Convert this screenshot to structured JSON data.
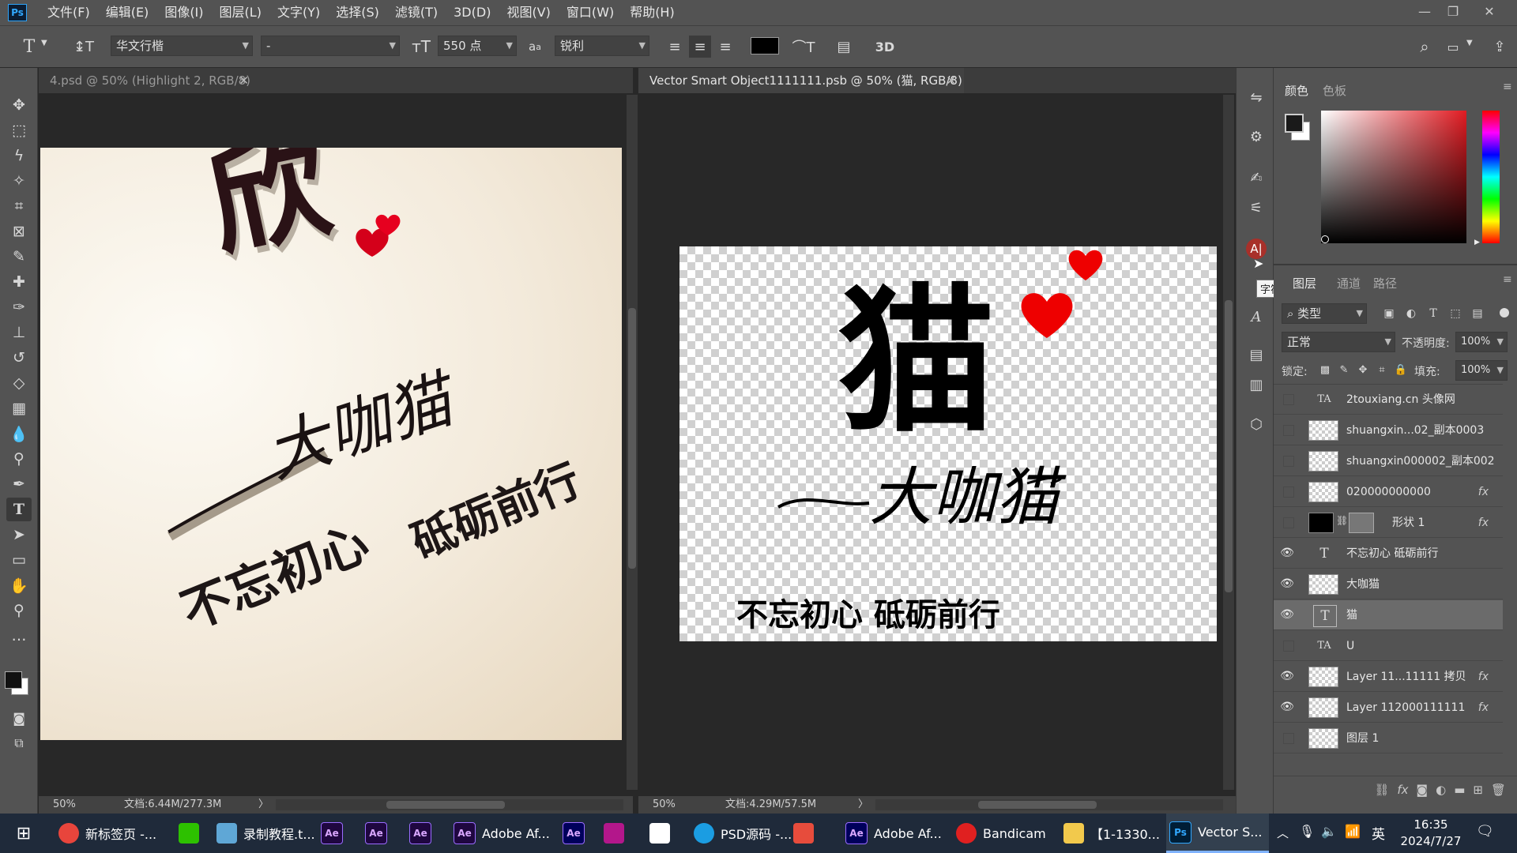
{
  "menubar": {
    "logo": "Ps",
    "items": [
      "文件(F)",
      "编辑(E)",
      "图像(I)",
      "图层(L)",
      "文字(Y)",
      "选择(S)",
      "滤镜(T)",
      "3D(D)",
      "视图(V)",
      "窗口(W)",
      "帮助(H)"
    ]
  },
  "options": {
    "font_family": "华文行楷",
    "font_style": "-",
    "font_size": "550 点",
    "aa_label": "a",
    "antialias": "锐利",
    "text_color": "#000000",
    "three_d_label": "3D"
  },
  "doc_left": {
    "tab": "4.psd @ 50% (Highlight 2, RGB/8)",
    "zoom": "50%",
    "doc_info": "文档:6.44M/277.3M",
    "art_char": "欣",
    "art_signature": "大咖猫",
    "art_slogan_1": "不忘初心",
    "art_slogan_2": "砥砺前行"
  },
  "doc_right": {
    "tab": "Vector Smart Object1111111.psb @ 50% (猫, RGB/8) *",
    "zoom": "50%",
    "doc_info": "文档:4.29M/57.5M",
    "art_char": "猫",
    "art_signature": "大咖猫",
    "art_slogan": "不忘初心 砥砺前行"
  },
  "tooltip": "字符",
  "color_panel": {
    "tabs": [
      "颜色",
      "色板"
    ],
    "fg_color": "#1a1a1a",
    "bg_color": "#ffffff",
    "hue_color": "#e11b22"
  },
  "layers_panel": {
    "tabs": [
      "图层",
      "通道",
      "路径"
    ],
    "filter_label": "类型",
    "blend_mode": "正常",
    "opacity_label": "不透明度:",
    "opacity_value": "100%",
    "lock_label": "锁定:",
    "fill_label": "填充:",
    "fill_value": "100%",
    "layers": [
      {
        "name": "2touxiang.cn 头像网",
        "kind": "text-warp",
        "visible": false,
        "fx": ""
      },
      {
        "name": "shuangxin...02_副本0003",
        "kind": "image",
        "visible": false,
        "fx": ""
      },
      {
        "name": "shuangxin000002_副本002",
        "kind": "image",
        "visible": false,
        "fx": ""
      },
      {
        "name": "020000000000",
        "kind": "image",
        "visible": false,
        "fx": "fx"
      },
      {
        "name": "形状 1",
        "kind": "shape",
        "visible": false,
        "fx": "fx"
      },
      {
        "name": "不忘初心  砥砺前行",
        "kind": "text",
        "visible": true,
        "fx": ""
      },
      {
        "name": "大咖猫",
        "kind": "image",
        "visible": true,
        "fx": ""
      },
      {
        "name": "猫",
        "kind": "text",
        "visible": true,
        "fx": "",
        "selected": true
      },
      {
        "name": "U",
        "kind": "text-warp",
        "visible": false,
        "fx": ""
      },
      {
        "name": "Layer 11...11111 拷贝",
        "kind": "image",
        "visible": true,
        "fx": "fx"
      },
      {
        "name": "Layer 112000111111",
        "kind": "image",
        "visible": true,
        "fx": "fx"
      },
      {
        "name": "图层 1",
        "kind": "image",
        "visible": false,
        "fx": ""
      }
    ]
  },
  "taskbar": {
    "items": [
      {
        "label": "新标签页 -...",
        "icon": "chrome-icon",
        "color": "#e8453c"
      },
      {
        "label": "",
        "icon": "wechat-icon",
        "color": "#2dc100"
      },
      {
        "label": "录制教程.t...",
        "icon": "notepad-icon",
        "color": "#5fa7d6"
      },
      {
        "label": "",
        "icon": "ae-icon",
        "color": "#1f0740"
      },
      {
        "label": "",
        "icon": "ae-icon",
        "color": "#1f0740"
      },
      {
        "label": "",
        "icon": "ae-icon",
        "color": "#1f0740"
      },
      {
        "label": "Adobe Af...",
        "icon": "ae-icon",
        "color": "#1f0740"
      },
      {
        "label": "",
        "icon": "ae-icon",
        "color": "#00005b"
      },
      {
        "label": "",
        "icon": "app-icon",
        "color": "#b3178b"
      },
      {
        "label": "",
        "icon": "baidu-icon",
        "color": "#ffffff"
      },
      {
        "label": "PSD源码 -...",
        "icon": "edge-icon",
        "color": "#1b9de2"
      },
      {
        "label": "",
        "icon": "app-icon",
        "color": "#e74c3c"
      },
      {
        "label": "Adobe Af...",
        "icon": "ae-icon",
        "color": "#00005b"
      },
      {
        "label": "Bandicam",
        "icon": "record-icon",
        "color": "#e02020"
      },
      {
        "label": "【1-1330...",
        "icon": "folder-icon",
        "color": "#f2c94c"
      },
      {
        "label": "Vector S...",
        "icon": "ps-icon",
        "color": "#001e36"
      }
    ],
    "ime": "英",
    "time": "16:35",
    "date": "2024/7/27"
  }
}
